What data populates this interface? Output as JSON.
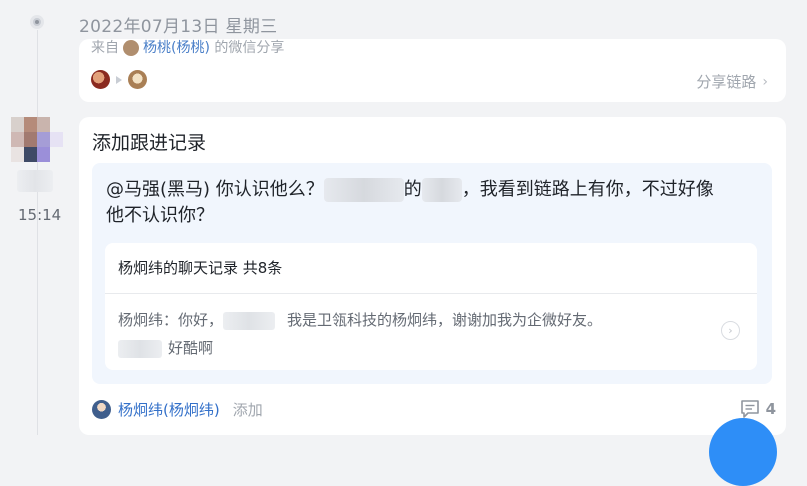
{
  "timeline": {
    "date": "2022年07月13日 星期三"
  },
  "top_card": {
    "truncated_prefix": "来自",
    "truncated_user": "杨桃(杨桃)",
    "truncated_suffix": "的微信分享",
    "share_link_label": "分享链路"
  },
  "entry": {
    "time": "15:14",
    "title": "添加跟进记录",
    "message_line1_a": "@马强(黑马) 你认识他么？",
    "message_line1_b": "的",
    "message_line1_c": "，我看到链路上有你，不过好像",
    "message_line2": "他不认识你？",
    "chat_record": {
      "title": "杨炯纬的聊天记录 共8条",
      "line1_a": "杨炯纬：你好，",
      "line1_b": "我是卫瓴科技的杨炯纬，谢谢加我为企微好友。",
      "line2": "好酷啊"
    },
    "author": "杨炯纬(杨炯纬)",
    "add_label": "添加",
    "comment_count": "4"
  },
  "colors": {
    "accent": "#3370c9",
    "fab": "#2e8ef7",
    "bubble": "#f1f6fd"
  },
  "icons": [
    "arrow-right-icon",
    "chevron-right-icon",
    "comment-icon"
  ]
}
